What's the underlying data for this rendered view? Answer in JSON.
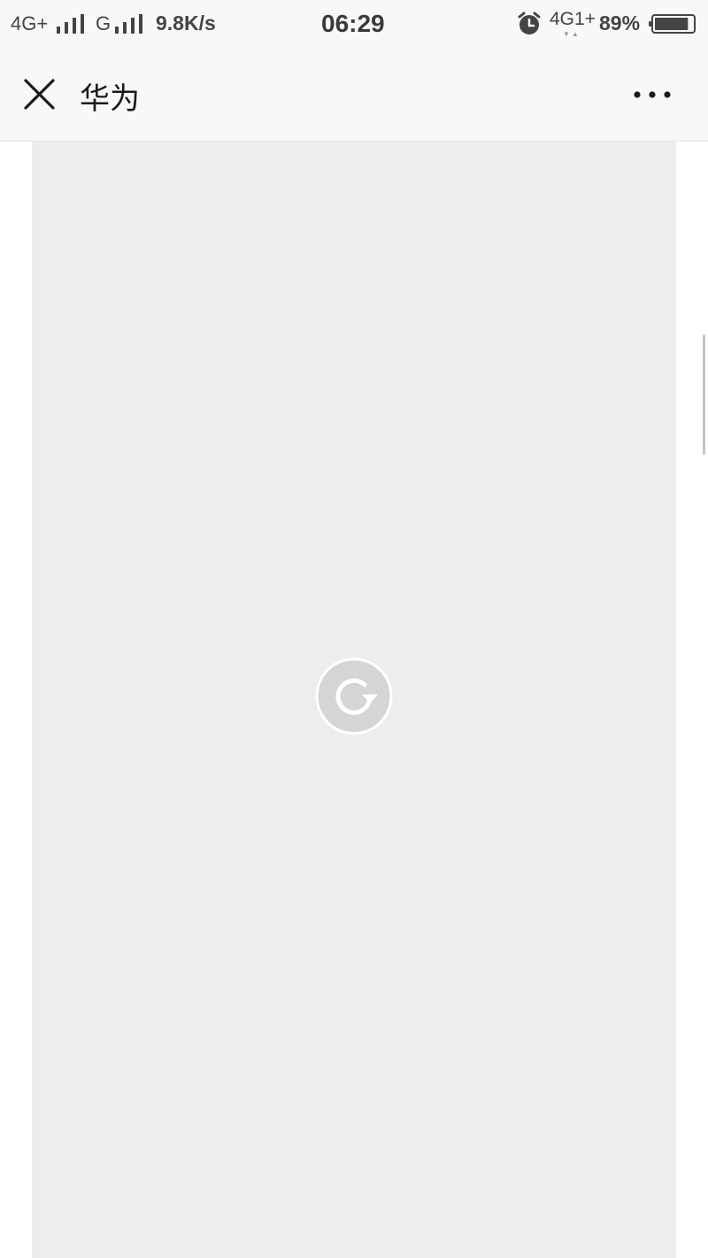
{
  "status_bar": {
    "network_1": "4G+",
    "network_2": "G",
    "speed": "9.8K/s",
    "time": "06:29",
    "network_3": "4G1+",
    "network_3_arrows": "▼▲",
    "battery": "89%",
    "battery_level": 0.89,
    "icons": [
      "signal-icon",
      "signal-icon",
      "alarm-icon",
      "battery-icon"
    ]
  },
  "nav": {
    "title": "华为",
    "close_icon": "close-icon",
    "more_icon": "more-icon"
  },
  "content": {
    "reload_icon": "reload-icon",
    "panel_color": "#eeedec"
  }
}
